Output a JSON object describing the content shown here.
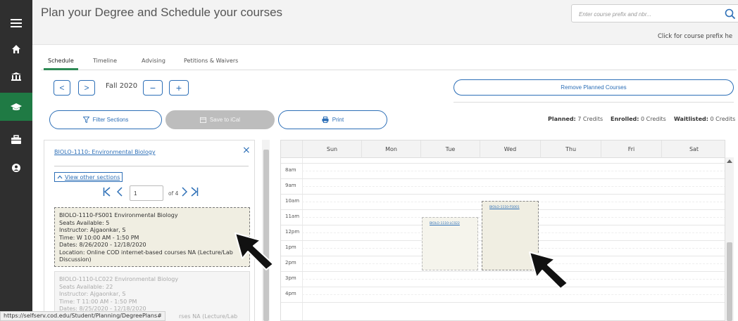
{
  "header": {
    "title": "Plan your Degree and Schedule your courses",
    "search_placeholder": "Enter course prefix and nbr...",
    "prefix_help": "Click for course prefix he"
  },
  "tabs": [
    {
      "label": "Schedule",
      "active": true
    },
    {
      "label": "Timeline"
    },
    {
      "label": "Advising"
    },
    {
      "label": "Petitions & Waivers"
    }
  ],
  "term": {
    "label": "Fall 2020",
    "prev_symbol": "<",
    "next_symbol": ">",
    "remove_symbol": "−",
    "add_symbol": "+"
  },
  "actions": {
    "remove_planned": "Remove Planned Courses",
    "filter_sections": "Filter Sections",
    "save_ical": "Save to iCal",
    "print": "Print"
  },
  "credits": {
    "planned_label": "Planned:",
    "planned_value": "7 Credits",
    "enrolled_label": "Enrolled:",
    "enrolled_value": "0 Credits",
    "waitlisted_label": "Waitlisted:",
    "waitlisted_value": "0 Credits"
  },
  "section_panel": {
    "course": "BIOLO-1110: Environmental Biology",
    "close_symbol": "×",
    "view_other": "View other sections",
    "page": "1",
    "of_text": "of 4",
    "sections": [
      {
        "title": "BIOLO-1110-FS001 Environmental Biology",
        "seats": "Seats Available: 5",
        "instructor": "Instructor: Ajgaonkar, S",
        "time": "Time: W 10:00 AM - 1:50 PM",
        "dates": "Dates: 8/26/2020 - 12/18/2020",
        "location": "Location: Online COD internet-based courses NA (Lecture/Lab",
        "location2": "Discussion)"
      },
      {
        "title": "BIOLO-1110-LC022 Environmental Biology",
        "seats": "Seats Available: 22",
        "instructor": "Instructor: Ajgaonkar, S",
        "time": "Time: T 11:00 AM - 1:50 PM",
        "dates": "Dates: 8/25/2020 - 12/18/2020",
        "location": "rses NA (Lecture/Lab"
      }
    ]
  },
  "calendar": {
    "days": [
      "Sun",
      "Mon",
      "Tue",
      "Wed",
      "Thu",
      "Fri",
      "Sat"
    ],
    "hours": [
      "8am",
      "9am",
      "10am",
      "11am",
      "12pm",
      "1pm",
      "2pm",
      "3pm",
      "4pm"
    ],
    "events": [
      {
        "label": "BIOLO-1110-LC022",
        "day": "Tue"
      },
      {
        "label": "BIOLO-1110-FS001",
        "day": "Wed"
      }
    ]
  },
  "status_url": "https://selfserv.cod.edu/Student/Planning/DegreePlans#",
  "colors": {
    "accent_blue": "#2d6fb7",
    "active_green": "#1f7a44",
    "rail_dark": "#2f2f2f"
  }
}
